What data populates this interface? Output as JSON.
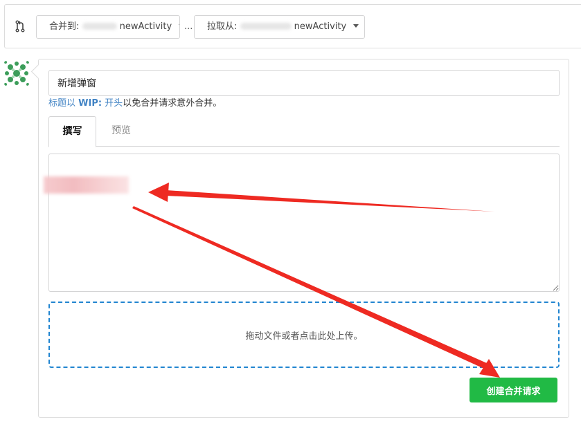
{
  "branch_bar": {
    "base_label": "合并到:",
    "base_branch_suffix": "newActivity",
    "separator": "...",
    "head_label": "拉取从:",
    "head_branch_suffix": "newActivity"
  },
  "form": {
    "title_value": "新增弹窗",
    "wip_hint": {
      "prefix": "标题以 ",
      "keyword": "WIP:",
      "middle": " 开头",
      "suffix": "以免合并请求意外合并。"
    },
    "tabs": [
      {
        "label": "撰写",
        "active": true
      },
      {
        "label": "预览",
        "active": false
      }
    ],
    "dropzone_text": "拖动文件或者点击此处上传。",
    "create_button_label": "创建合并请求"
  },
  "colors": {
    "accent_blue": "#4183c4",
    "dropzone_border": "#2185d0",
    "create_button": "#21ba45",
    "annotation_arrow": "#ee2a22"
  },
  "icons": {
    "pr": "git-pull-request-icon",
    "caret": "caret-down-icon"
  }
}
